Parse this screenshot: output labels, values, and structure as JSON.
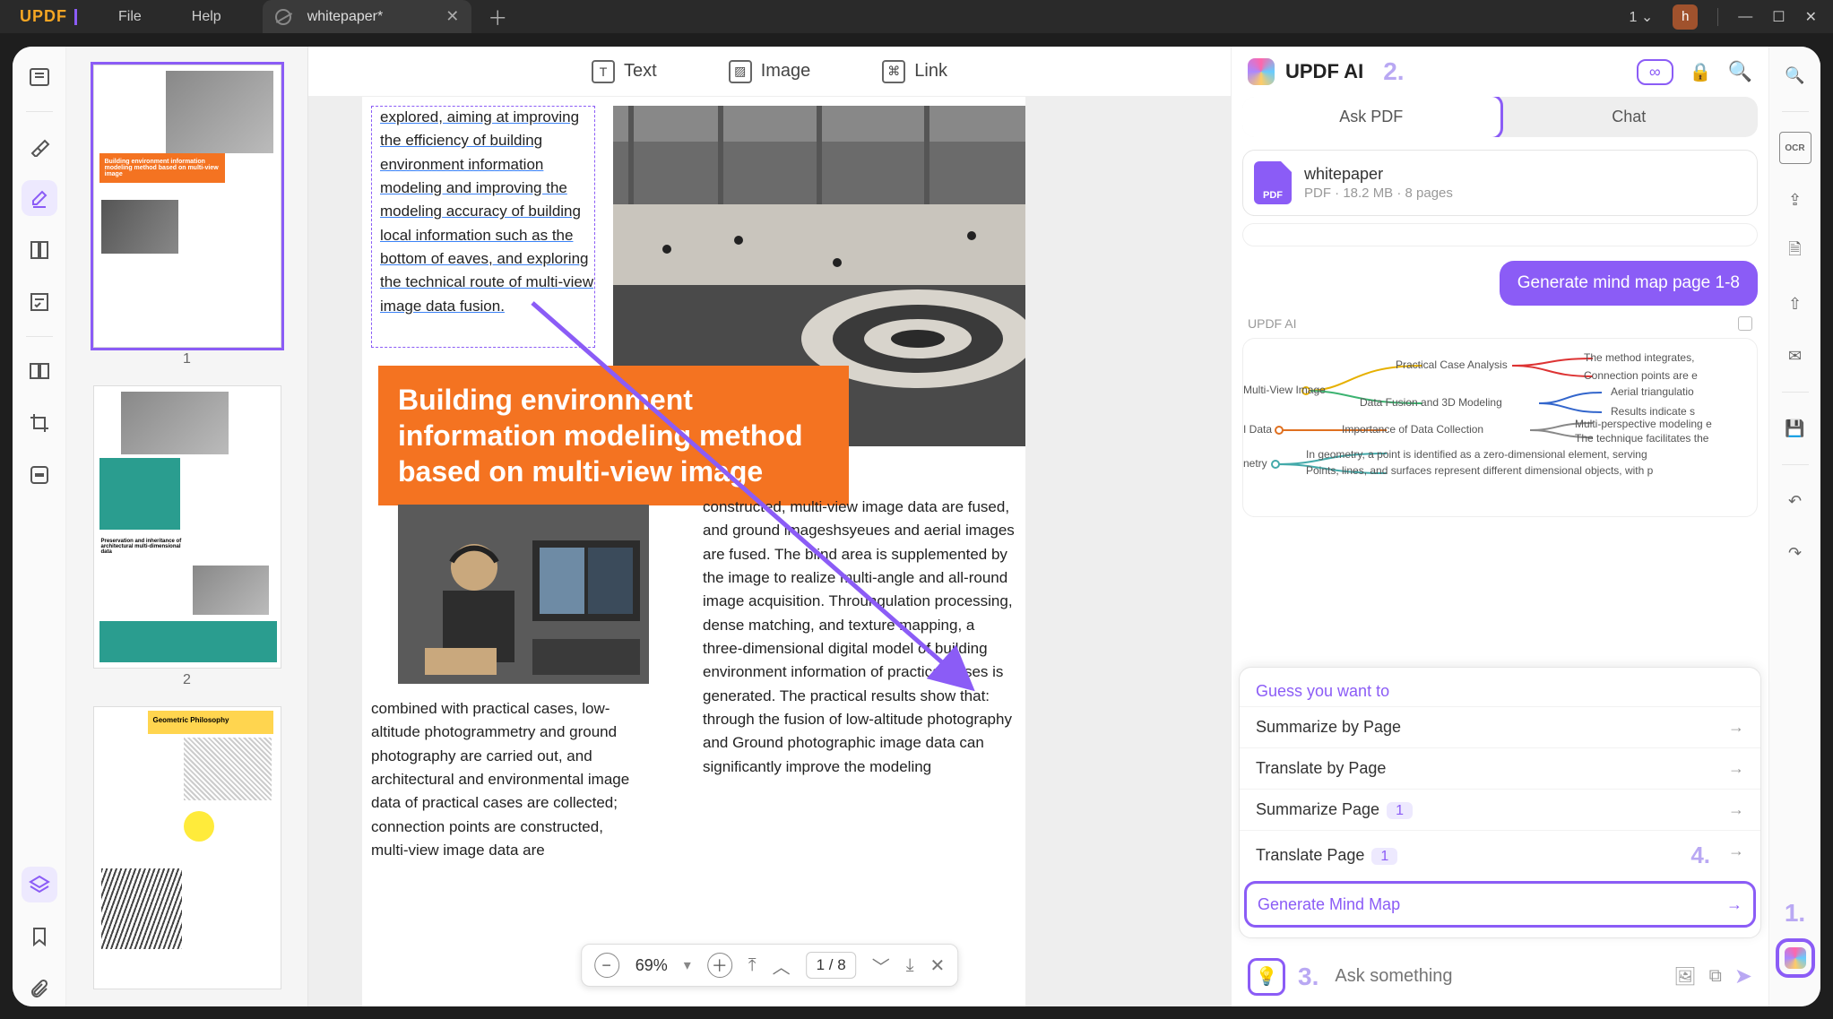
{
  "app": {
    "logo": "UPDF"
  },
  "menu": {
    "file": "File",
    "help": "Help"
  },
  "tab": {
    "title": "whitepaper*",
    "user_initial": "h",
    "tab_count": "1"
  },
  "edit_tabs": {
    "text": "Text",
    "image": "Image",
    "link": "Link"
  },
  "thumbs": {
    "n1": "1",
    "n2": "2"
  },
  "doc": {
    "para1": "explored, aiming at improving the efficiency of building environment information modeling and improving the modeling accuracy of building local information such as the bottom of eaves, and exploring the technical route of multi-view image data fusion.",
    "title": "Building environment information modeling method based on multi-view image",
    "para2": "combined with practical cases, low-altitude photogrammetry and ground photography are carried out, and architectural and environmental image data of practical cases are collected; connection points are constructed, multi-view image data are",
    "para3": "constructed, multi-view image data are fused, and ground imageshsyeues and aerial images are fused. The blind area is supplemented by the image to realize multi-angle and all-round image acquisition. Throungulation processing, dense matching, and texture mapping, a three-dimensional digital model of building environment information of practical cases is generated. The practical results show that: through the fusion of low-altitude photography and Ground photographic image data can significantly improve the modeling"
  },
  "zoom": {
    "level": "69%",
    "page": "1  /  8"
  },
  "ai": {
    "brand": "UPDF AI",
    "tab_ask": "Ask PDF",
    "tab_chat": "Chat",
    "file_name": "whitepaper",
    "file_meta": "PDF  ·  18.2 MB  ·  8 pages",
    "bubble": "Generate mind map page 1-8",
    "source_label": "UPDF AI",
    "suggest_title": "Guess you want to",
    "s1": "Summarize by Page",
    "s2": "Translate by Page",
    "s3": "Summarize Page",
    "s3_pg": "1",
    "s4": "Translate Page",
    "s4_pg": "1",
    "s5": "Generate Mind Map",
    "placeholder": "Ask something"
  },
  "mind": {
    "n1": "Multi-View Image",
    "n2": "I Data",
    "n3": "netry",
    "b1": "Practical Case Analysis",
    "b2": "Data Fusion and 3D Modeling",
    "b3": "Importance of Data Collection",
    "c1": "The method integrates,",
    "c2": "Connection points are e",
    "c3": "Aerial triangulatio",
    "c4": "Results indicate s",
    "c5": "Multi-perspective modeling e",
    "c6": "The technique facilitates the",
    "d1": "In geometry, a point is identified as a zero-dimensional element, serving",
    "d2": "Points, lines, and surfaces represent different dimensional objects, with p"
  },
  "callouts": {
    "c1": "1.",
    "c2": "2.",
    "c3": "3.",
    "c4": "4."
  }
}
